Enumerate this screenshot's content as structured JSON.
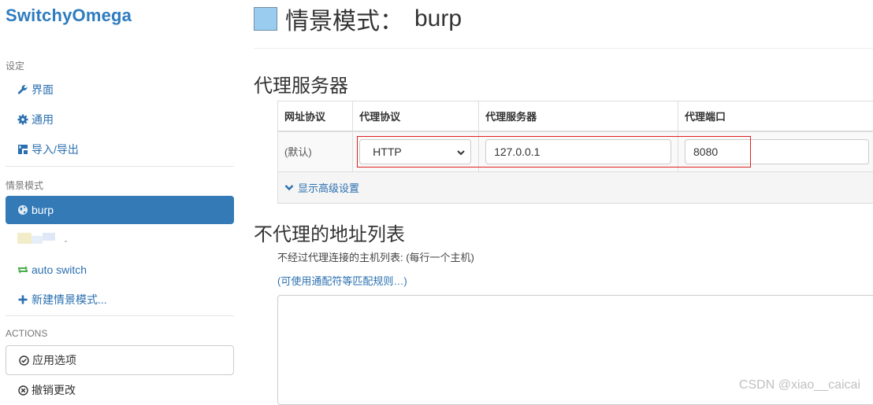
{
  "app": {
    "brand": "SwitchyOmega"
  },
  "sidebar": {
    "settings_header": "设定",
    "settings_items": [
      {
        "label": "界面",
        "icon": "wrench-icon"
      },
      {
        "label": "通用",
        "icon": "gear-icon"
      },
      {
        "label": "导入/导出",
        "icon": "import-export-icon"
      }
    ],
    "profiles_header": "情景模式",
    "profiles": [
      {
        "label": "burp",
        "icon": "globe-icon",
        "active": true
      },
      {
        "label": "",
        "icon": "blurred-profile",
        "active": false
      },
      {
        "label": "auto switch",
        "icon": "auto-switch-icon",
        "active": false
      },
      {
        "label": "新建情景模式...",
        "icon": "plus-icon",
        "active": false
      }
    ],
    "actions_header": "ACTIONS",
    "apply_label": "应用选项",
    "discard_label": "撤销更改"
  },
  "main": {
    "title_prefix": "情景模式：",
    "profile_name": "burp",
    "profile_color": "#99ccee",
    "proxy_section_title": "代理服务器",
    "table": {
      "headers": [
        "网址协议",
        "代理协议",
        "代理服务器",
        "代理端口"
      ],
      "row": {
        "scheme": "(默认)",
        "protocol": "HTTP",
        "server": "127.0.0.1",
        "port": "8080"
      },
      "advanced_label": "显示高级设置"
    },
    "bypass_section_title": "不代理的地址列表",
    "bypass_description": "不经过代理连接的主机列表: (每行一个主机)",
    "bypass_link": "(可使用通配符等匹配规则…)",
    "bypass_value": ""
  },
  "watermark": "CSDN @xiao__caicai",
  "colors": {
    "accent": "#337ab7",
    "link": "#2a6fb0",
    "highlight_box": "#e02020"
  }
}
